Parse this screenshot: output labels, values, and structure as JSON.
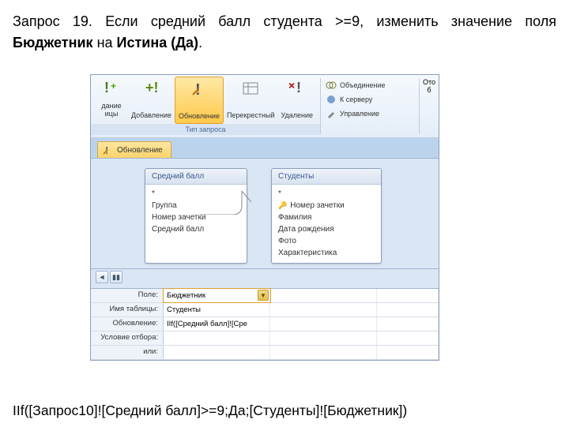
{
  "title": {
    "prefix": "Запрос 19. Если средний балл студента >=9, изменить значение поля ",
    "bold1": "Бюджетник",
    "mid": " на ",
    "bold2": "Истина (Да)",
    "suffix": "."
  },
  "ribbon": {
    "buttons": [
      {
        "label": "дание",
        "sub": "ицы"
      },
      {
        "label": "Добавление"
      },
      {
        "label": "Обновление",
        "selected": true
      },
      {
        "label": "Перекрестный"
      },
      {
        "label": "Удаление"
      }
    ],
    "group_label": "Тип запроса",
    "side": [
      {
        "label": "Объединение"
      },
      {
        "label": "К серверу"
      },
      {
        "label": "Управление"
      }
    ],
    "far_right": "Ото\nб"
  },
  "object_tab": "Обновление",
  "tables": {
    "left": {
      "title": "Средний балл",
      "fields": [
        "*",
        "Группа",
        "Номер зачетки",
        "Средний балл"
      ]
    },
    "right": {
      "title": "Студенты",
      "fields": [
        {
          "v": "*"
        },
        {
          "v": "Номер зачетки",
          "pk": true
        },
        {
          "v": "Фамилия"
        },
        {
          "v": "Дата рождения"
        },
        {
          "v": "Фото"
        },
        {
          "v": "Характеристика"
        }
      ]
    }
  },
  "grid": {
    "rows": {
      "field_label": "Поле:",
      "field_value": "Бюджетник",
      "table_label": "Имя таблицы:",
      "table_value": "Студенты",
      "update_label": "Обновление:",
      "update_value": "IIf([Средний балл]![Сре",
      "criteria_label": "Условие отбора:",
      "or_label": "или:"
    }
  },
  "footer": "IIf([Запрос10]![Средний балл]>=9;Да;[Студенты]![Бюджетник])"
}
